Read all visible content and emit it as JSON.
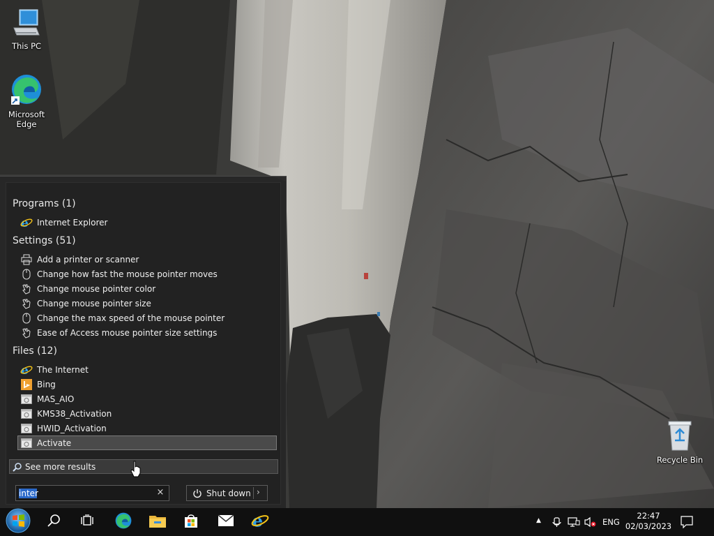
{
  "desktop": {
    "icons": [
      {
        "label": "This PC"
      },
      {
        "label": "Microsoft\nEdge"
      },
      {
        "label": "Recycle Bin"
      }
    ]
  },
  "start_menu": {
    "groups": {
      "programs": {
        "header": "Programs (1)",
        "items": [
          "Internet Explorer"
        ]
      },
      "settings": {
        "header": "Settings (51)",
        "items": [
          "Add a printer or scanner",
          "Change how fast the mouse pointer moves",
          "Change mouse pointer color",
          "Change mouse pointer size",
          "Change the max speed of the mouse pointer",
          "Ease of Access mouse pointer size settings"
        ]
      },
      "files": {
        "header": "Files (12)",
        "items": [
          "The Internet",
          "Bing",
          "MAS_AIO",
          "KMS38_Activation",
          "HWID_Activation",
          "Activate"
        ]
      }
    },
    "see_more": "See more results",
    "search": {
      "value": "inter",
      "clear": "×"
    },
    "shutdown": {
      "label": "Shut down",
      "arrow": "›"
    }
  },
  "taskbar": {
    "tray": {
      "chevron": "▲",
      "language": "ENG"
    },
    "clock": {
      "time": "22:47",
      "date": "02/03/2023"
    }
  },
  "icons": {
    "search": "search-icon",
    "task_view": "task-view-icon",
    "edge": "edge-icon",
    "explorer": "file-explorer-icon",
    "store": "store-icon",
    "mail": "mail-icon",
    "ie": "internet-explorer-icon"
  }
}
